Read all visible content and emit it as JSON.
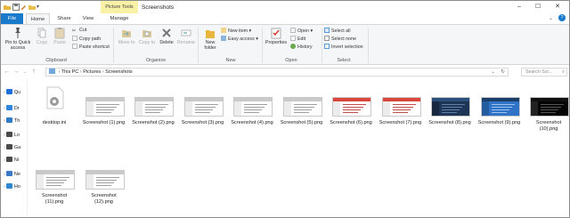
{
  "window": {
    "title": "Screenshots",
    "context_tab": "Picture Tools",
    "controls": {
      "minimize": "–",
      "maximize": "☐",
      "close": "✕"
    }
  },
  "ribbon_tabs": {
    "file": "File",
    "home": "Home",
    "share": "Share",
    "view": "View",
    "manage": "Manage"
  },
  "ribbon": {
    "clipboard": {
      "pin": "Pin to Quick access",
      "copy": "Copy",
      "paste": "Paste",
      "cut": "Cut",
      "copy_path": "Copy path",
      "paste_shortcut": "Paste shortcut",
      "label": "Clipboard"
    },
    "organize": {
      "move_to": "Move to",
      "copy_to": "Copy to",
      "delete": "Delete",
      "rename": "Rename",
      "label": "Organize"
    },
    "new": {
      "new_folder": "New folder",
      "new_item": "New item",
      "easy_access": "Easy access",
      "label": "New"
    },
    "open": {
      "properties": "Properties",
      "open": "Open",
      "edit": "Edit",
      "history": "History",
      "label": "Open"
    },
    "select": {
      "select_all": "Select all",
      "select_none": "Select none",
      "invert_selection": "Invert selection",
      "label": "Select"
    }
  },
  "address": {
    "breadcrumbs": [
      "This PC",
      "Pictures",
      "Screenshots"
    ],
    "search_placeholder": "Search Scr..."
  },
  "nav_pane": {
    "items": [
      {
        "label": "Qu",
        "icon": "star-icon",
        "color": "#1e6fd9"
      },
      {
        "label": "Dr",
        "icon": "dropbox-icon",
        "color": "#2e86de"
      },
      {
        "label": "Th",
        "icon": "pc-icon",
        "color": "#2c7bc4"
      },
      {
        "label": "Lo",
        "icon": "drive-icon",
        "color": "#4a4a4a"
      },
      {
        "label": "Ga",
        "icon": "drive-icon",
        "color": "#4a4a4a"
      },
      {
        "label": "Ni",
        "icon": "drive-icon",
        "color": "#4a4a4a"
      },
      {
        "label": "Ne",
        "icon": "network-icon",
        "color": "#3a78c8"
      },
      {
        "label": "Ho",
        "icon": "homegroup-icon",
        "color": "#2f86d1"
      }
    ]
  },
  "files": [
    {
      "name": "desktop.ini",
      "kind": "ini"
    },
    {
      "name": "Screenshot (1).png",
      "kind": "light"
    },
    {
      "name": "Screenshot (2).png",
      "kind": "light"
    },
    {
      "name": "Screenshot (3).png",
      "kind": "light"
    },
    {
      "name": "Screenshot (4).png",
      "kind": "light"
    },
    {
      "name": "Screenshot (5).png",
      "kind": "light"
    },
    {
      "name": "Screenshot (6).png",
      "kind": "red"
    },
    {
      "name": "Screenshot (7).png",
      "kind": "red"
    },
    {
      "name": "Screenshot (8).png",
      "kind": "blue"
    },
    {
      "name": "Screenshot (9).png",
      "kind": "desktop"
    },
    {
      "name": "Screenshot (10).png",
      "kind": "dark"
    },
    {
      "name": "Screenshot (11).png",
      "kind": "light"
    },
    {
      "name": "Screenshot (12).png",
      "kind": "light"
    }
  ],
  "colors": {
    "accent": "#1979ca",
    "context_tab": "#f9f1a5"
  }
}
